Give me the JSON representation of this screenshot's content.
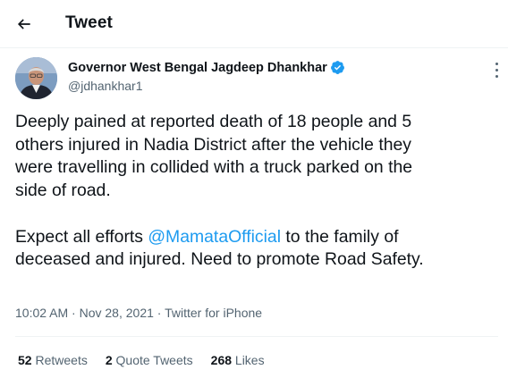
{
  "header": {
    "back_icon": "arrow-left-icon",
    "title": "Tweet"
  },
  "author": {
    "name": "Governor West Bengal Jagdeep Dhankhar",
    "handle": "@jdhankhar1",
    "verified_icon": "verified-badge-icon",
    "verified_color": "#1d9bf0"
  },
  "tweet": {
    "line1": "Deeply pained at reported death of 18 people and 5",
    "line2": "others injured in Nadia District after the vehicle they",
    "line3": "were travelling in collided with a truck parked on the",
    "line4": "side of road.",
    "line5_before": "Expect all efforts ",
    "mention": "@MamataOfficial",
    "line5_after": " to the family of",
    "line6": "deceased and injured. Need to promote Road Safety."
  },
  "meta": {
    "time": "10:02 AM",
    "separator": " · ",
    "date": "Nov 28, 2021",
    "source": "Twitter for iPhone"
  },
  "stats": {
    "retweets_count": "52",
    "retweets_label": "Retweets",
    "quotes_count": "2",
    "quotes_label": "Quote Tweets",
    "likes_count": "268",
    "likes_label": "Likes"
  },
  "colors": {
    "link": "#1d9bf0",
    "secondary_text": "#536471",
    "primary_text": "#0f1419"
  }
}
